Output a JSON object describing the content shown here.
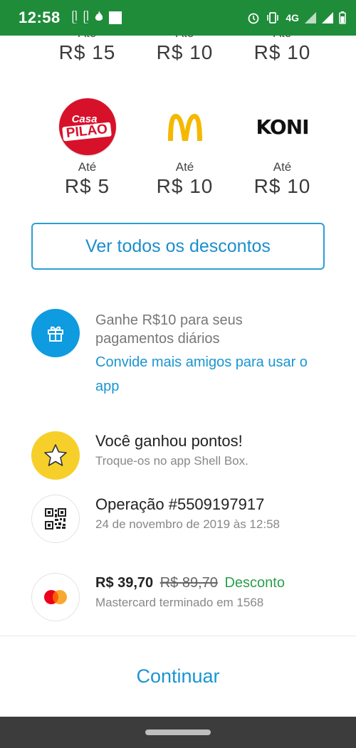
{
  "status_bar": {
    "time": "12:58",
    "network": "4G"
  },
  "brands_row1": [
    {
      "ate": "Até",
      "amount": "R$ 15"
    },
    {
      "ate": "Até",
      "amount": "R$ 10"
    },
    {
      "ate": "Até",
      "amount": "R$ 10"
    }
  ],
  "brands_row2": [
    {
      "name": "Casa Pilão",
      "logo_top": "Casa",
      "logo_bottom": "PILÃO",
      "ate": "Até",
      "amount": "R$ 5"
    },
    {
      "name": "McDonald's",
      "ate": "Até",
      "amount": "R$ 10"
    },
    {
      "name": "Koni",
      "logo_text": "KONI",
      "ate": "Até",
      "amount": "R$ 10"
    }
  ],
  "ver_todos_label": "Ver todos os descontos",
  "invite": {
    "text": "Ganhe R$10 para seus pagamentos diários",
    "link": "Convide mais amigos para usar o app"
  },
  "points": {
    "title": "Você ganhou pontos!",
    "subtitle": "Troque-os no app Shell Box."
  },
  "operation": {
    "title": "Operação #5509197917",
    "date": "24 de novembro de 2019 às 12:58"
  },
  "payment": {
    "price_new": "R$ 39,70",
    "price_old": "R$ 89,70",
    "discount_label": "Desconto",
    "card": "Mastercard terminado em 1568"
  },
  "continue_label": "Continuar",
  "colors": {
    "status_green": "#1f8c3a",
    "accent_blue": "#1a95d2",
    "discount_green": "#2a9f4a",
    "star_yellow": "#f7cf2b"
  }
}
